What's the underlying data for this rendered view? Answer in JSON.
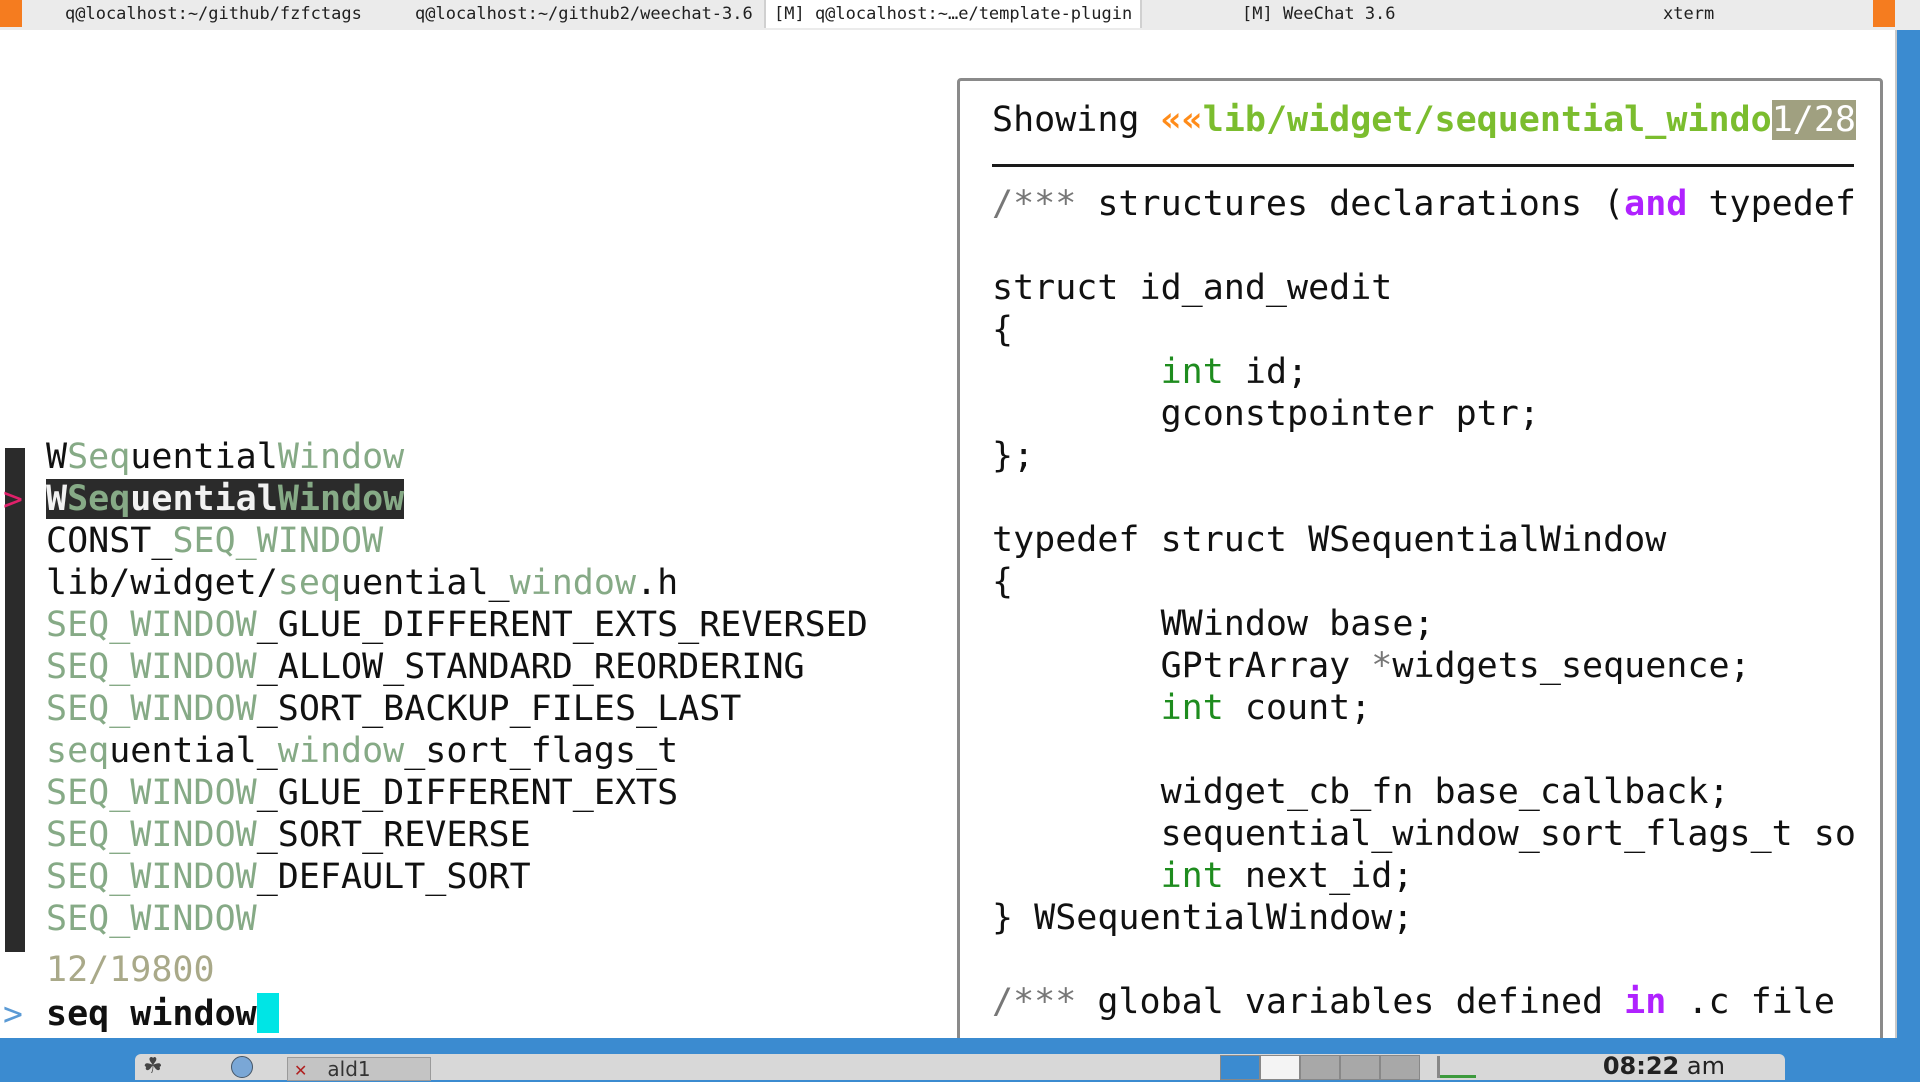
{
  "tabs": [
    {
      "label": "q@localhost:~/github/fzfctags"
    },
    {
      "label": "q@localhost:~/github2/weechat-3.6"
    },
    {
      "label": "[M] q@localhost:~…e/template-plugin"
    },
    {
      "label": "[M] WeeChat 3.6"
    },
    {
      "label": "xterm"
    }
  ],
  "results": [
    {
      "parts": [
        [
          "W",
          0
        ],
        [
          "Seq",
          1
        ],
        [
          "uential",
          0
        ],
        [
          "Window",
          1
        ]
      ]
    },
    {
      "parts": [
        [
          "W",
          0
        ],
        [
          "Seq",
          1
        ],
        [
          "uential",
          0
        ],
        [
          "Window",
          1
        ]
      ],
      "selected": true
    },
    {
      "parts": [
        [
          "CONST_",
          0
        ],
        [
          "SEQ_WINDOW",
          1
        ]
      ]
    },
    {
      "parts": [
        [
          "lib/widget/",
          0
        ],
        [
          "seq",
          1
        ],
        [
          "uential_",
          0
        ],
        [
          "window",
          1
        ],
        [
          ".h",
          0
        ]
      ]
    },
    {
      "parts": [
        [
          "SEQ_WINDOW",
          1
        ],
        [
          "_GLUE_DIFFERENT_EXTS_REVERSED",
          0
        ]
      ]
    },
    {
      "parts": [
        [
          "SEQ_WINDOW",
          1
        ],
        [
          "_ALLOW_STANDARD_REORDERING",
          0
        ]
      ]
    },
    {
      "parts": [
        [
          "SEQ_WINDOW",
          1
        ],
        [
          "_SORT_BACKUP_FILES_LAST",
          0
        ]
      ]
    },
    {
      "parts": [
        [
          "seq",
          1
        ],
        [
          "uential_",
          0
        ],
        [
          "window",
          1
        ],
        [
          "_sort_flags_t",
          0
        ]
      ]
    },
    {
      "parts": [
        [
          "SEQ_WINDOW",
          1
        ],
        [
          "_GLUE_DIFFERENT_EXTS",
          0
        ]
      ]
    },
    {
      "parts": [
        [
          "SEQ_WINDOW",
          1
        ],
        [
          "_SORT_REVERSE",
          0
        ]
      ]
    },
    {
      "parts": [
        [
          "SEQ_WINDOW",
          1
        ],
        [
          "_DEFAULT_SORT",
          0
        ]
      ]
    },
    {
      "parts": [
        [
          "SEQ_WINDOW",
          1
        ]
      ]
    }
  ],
  "match_count": "12/19800",
  "prompt": {
    "symbol": ">",
    "query": "seq window"
  },
  "preview": {
    "header": {
      "prefix": "Showing ",
      "arrows": "««",
      "filename": "lib/widget/sequential_windo",
      "position": "1/28"
    },
    "lines": [
      [
        [
          "/*** ",
          "c"
        ],
        [
          "structures declarations (",
          ""
        ],
        [
          "and",
          "k"
        ],
        [
          " typedef",
          ""
        ]
      ],
      [],
      [
        [
          "struct id_and_wedit",
          ""
        ]
      ],
      [
        [
          "{",
          ""
        ]
      ],
      [
        [
          "        ",
          ""
        ],
        [
          "int",
          "t"
        ],
        [
          " id;",
          ""
        ]
      ],
      [
        [
          "        gconstpointer ptr;",
          ""
        ]
      ],
      [
        [
          "};",
          ""
        ]
      ],
      [],
      [
        [
          "typedef struct WSequentialWindow",
          ""
        ]
      ],
      [
        [
          "{",
          ""
        ]
      ],
      [
        [
          "        WWindow base;",
          ""
        ]
      ],
      [
        [
          "        GPtrArray ",
          ""
        ],
        [
          "*",
          "c"
        ],
        [
          "widgets_sequence;",
          ""
        ]
      ],
      [
        [
          "        ",
          ""
        ],
        [
          "int",
          "t"
        ],
        [
          " count;",
          ""
        ]
      ],
      [],
      [
        [
          "        widget_cb_fn base_callback;",
          ""
        ]
      ],
      [
        [
          "        sequential_window_sort_flags_t so",
          ""
        ]
      ],
      [
        [
          "        ",
          ""
        ],
        [
          "int",
          "t"
        ],
        [
          " next_id;",
          ""
        ]
      ],
      [
        [
          "} WSequentialWindow;",
          ""
        ]
      ],
      [],
      [
        [
          "/*** ",
          "c"
        ],
        [
          "global variables defined ",
          ""
        ],
        [
          "in",
          "k"
        ],
        [
          " .c file",
          ""
        ]
      ]
    ]
  },
  "taskbar": {
    "task_label": "ald1",
    "clock_time": "08:22",
    "clock_ampm": "am"
  }
}
